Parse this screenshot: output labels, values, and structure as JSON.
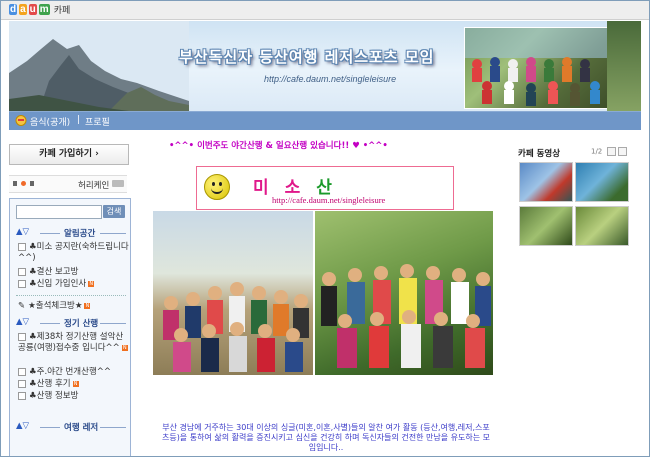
{
  "topbar": {
    "logo_text": "daum",
    "cafe_label": "카페"
  },
  "banner": {
    "title": "부산독신자 등산여행 레저스포츠 모임",
    "url": "http://cafe.daum.net/singleleisure"
  },
  "menubar": {
    "item1": "음식(공개)",
    "item2": "프로필"
  },
  "join_button": "카페 가입하기 ›",
  "player": {
    "label": "허리케인"
  },
  "sidebar": {
    "search_button": "검색",
    "group1": "알림공간",
    "group1_items": [
      "♣미소 공지란(숙하드립니다^^)",
      "♣결산 보고방",
      "♣신입 가입인사"
    ],
    "special_item": "★출석체크방★",
    "group2": "정기 산행",
    "group2_items": [
      "♣제38차 정기산행 설악산공룡(여행)접수중 입니다^^",
      "♣주.야간 번개산행^^",
      "♣산행 후기",
      "♣산행 정보방"
    ],
    "group3": "여행 레저"
  },
  "main": {
    "notice": "•^^• 이번주도 야간산행 & 일요산행 있습니다!! ♥ •^^•",
    "title_chars": [
      "미",
      "소",
      "산"
    ],
    "title_url": "http://cafe.daum.net/singleleisure",
    "description": "부산 경남에 거주하는 30대 이상의 싱글(미혼,이혼,사별)들의 알찬 여가 활동 (등산,여행,레저,스포츠등)을 통하여 삶의 활력을 증진시키고 심신을 건강히 하며 독신자들의 건전한 만남을 유도하는 모임입니다.."
  },
  "right": {
    "title": "카페 동영상",
    "pager": "1/2"
  },
  "colors": {
    "menubar": "#6f96c8",
    "notice": "#c300c3",
    "title_pink": "#e0188a",
    "title_green": "#1a9a2a"
  }
}
